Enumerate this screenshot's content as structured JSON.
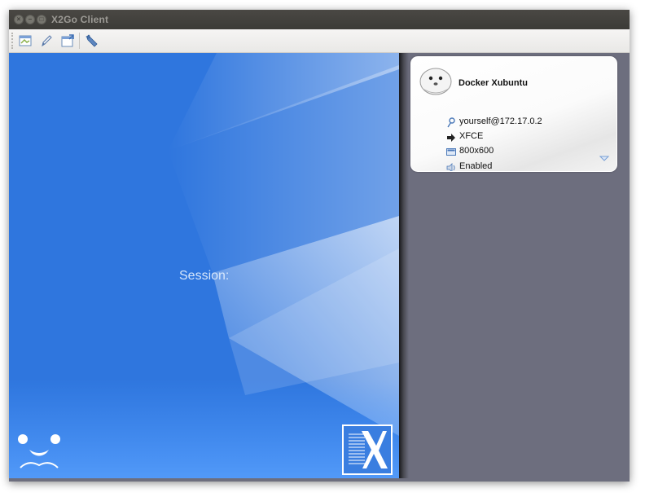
{
  "window": {
    "title": "X2Go Client",
    "buttons": [
      "close",
      "minimize",
      "maximize"
    ]
  },
  "toolbar": {
    "items": [
      {
        "icon": "new-session-icon"
      },
      {
        "icon": "edit-session-icon"
      },
      {
        "icon": "export-session-icon"
      },
      {
        "icon": "wrench-icon"
      }
    ]
  },
  "main": {
    "session_label": "Session:"
  },
  "session_card": {
    "name": "Docker Xubuntu",
    "details": [
      {
        "icon": "key-icon",
        "text": "yourself@172.17.0.2"
      },
      {
        "icon": "arrow-right-icon",
        "text": "XFCE"
      },
      {
        "icon": "display-icon",
        "text": "800x600"
      },
      {
        "icon": "speaker-icon",
        "text": "Enabled"
      }
    ]
  },
  "colors": {
    "titlebar": "#3c3b37",
    "left_pane": "#2f76de",
    "right_pane": "#6d6e7e",
    "card": "#ffffff"
  }
}
